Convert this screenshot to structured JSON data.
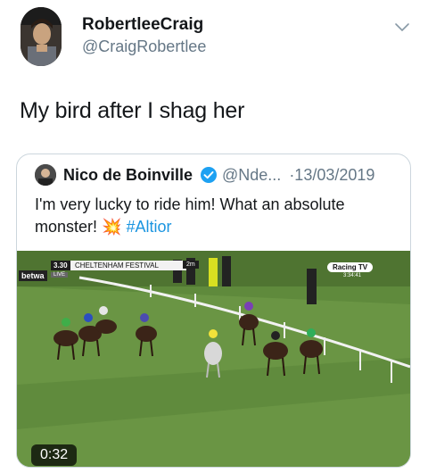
{
  "author": {
    "display_name": "RobertleeCraig",
    "handle": "@CraigRobertlee"
  },
  "tweet": {
    "text": "My bird after I shag her"
  },
  "quoted": {
    "name": "Nico de Boinville",
    "handle": "@Nde...",
    "date": "·13/03/2019",
    "text_part1": "I'm very lucky to ride him! What an absolute monster!",
    "emoji": "💥",
    "hashtag": "#Altior",
    "video_duration": "0:32"
  },
  "overlay": {
    "race_time": "3.30",
    "event": "CHELTENHAM FESTIVAL",
    "distance": "2m",
    "live": "LIVE",
    "brand": "betwa",
    "channel": "Racing TV",
    "clock": "3:34:41"
  },
  "icons": {
    "menu": "chevron-down-icon",
    "verified": "verified-badge-icon"
  },
  "colors": {
    "link": "#1b95e0",
    "secondary_text": "#657786",
    "verified": "#1da1f2",
    "turf": "#5f8a3c"
  }
}
